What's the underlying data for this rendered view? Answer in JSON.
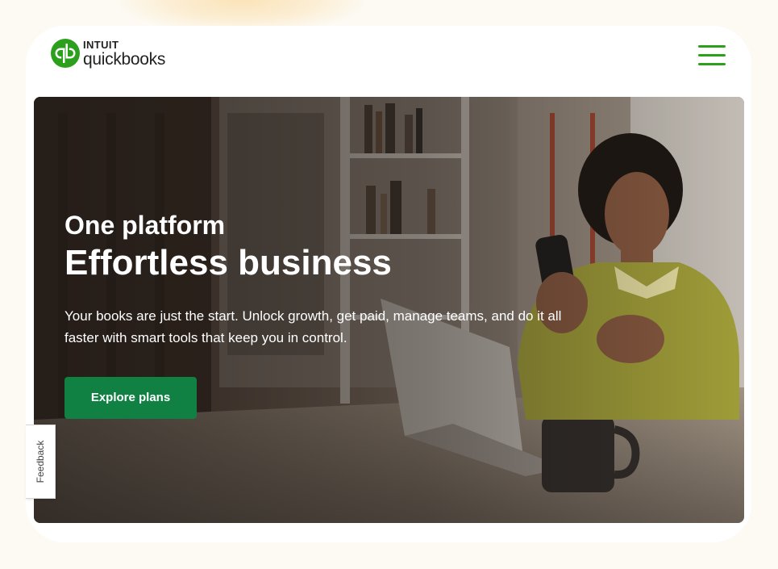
{
  "brand": {
    "intuit": "INTUIT",
    "name": "quickbooks",
    "green": "#2ca01c"
  },
  "header": {
    "menu_icon": "hamburger-menu-icon"
  },
  "hero": {
    "eyebrow": "One platform",
    "headline": "Effortless business",
    "subcopy": "Your books are just the start. Unlock growth, get paid, manage teams, and do it all faster with smart tools that keep you in control.",
    "cta_label": "Explore plans",
    "cta_color": "#108043"
  },
  "feedback": {
    "label": "Feedback"
  }
}
